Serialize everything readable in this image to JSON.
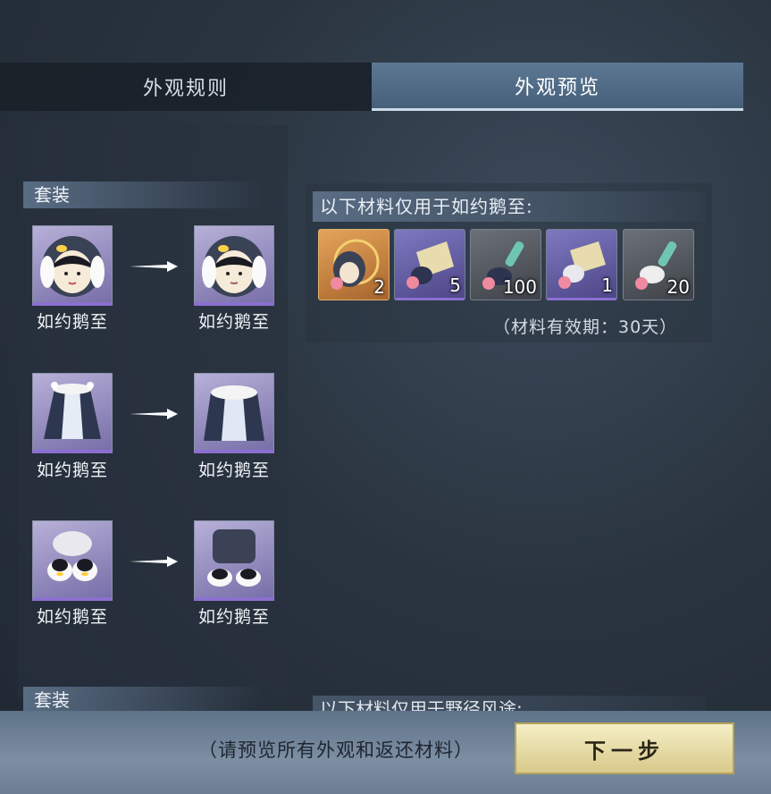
{
  "tabs": [
    {
      "label": "外观规则",
      "active": false
    },
    {
      "label": "外观预览",
      "active": true
    }
  ],
  "sections": [
    {
      "title": "套装",
      "pairs": [
        {
          "from_name": "如约鹅至",
          "to_name": "如约鹅至",
          "icon": "penguin-hood-head-icon"
        },
        {
          "from_name": "如约鹅至",
          "to_name": "如约鹅至",
          "icon": "penguin-cloak-outfit-icon"
        },
        {
          "from_name": "如约鹅至",
          "to_name": "如约鹅至",
          "icon": "penguin-slippers-icon"
        }
      ]
    },
    {
      "title": "套装"
    }
  ],
  "materials": {
    "label": "以下材料仅用于如约鹅至:",
    "items": [
      {
        "count": "2",
        "rarity": "gold",
        "icon": "penguin-hood-token-icon"
      },
      {
        "count": "5",
        "rarity": "purple",
        "icon": "gold-ticket-material-icon"
      },
      {
        "count": "100",
        "rarity": "gray",
        "icon": "fabric-roll-material-icon"
      },
      {
        "count": "1",
        "rarity": "purple",
        "icon": "gold-ticket-material-icon"
      },
      {
        "count": "20",
        "rarity": "gray",
        "icon": "fabric-roll-material-icon"
      }
    ],
    "validity": "（材料有效期：30天）"
  },
  "next_section_label_partial": "以下材料仅用于野径风途:",
  "footer": {
    "hint": "（请预览所有外观和返还材料）",
    "next_button": "下一步"
  },
  "colors": {
    "tab_active": "#5d7894",
    "rarity_purple": "#8b6fd0",
    "rarity_gold": "#e5a45a",
    "button_gold": "#f5efc6"
  }
}
